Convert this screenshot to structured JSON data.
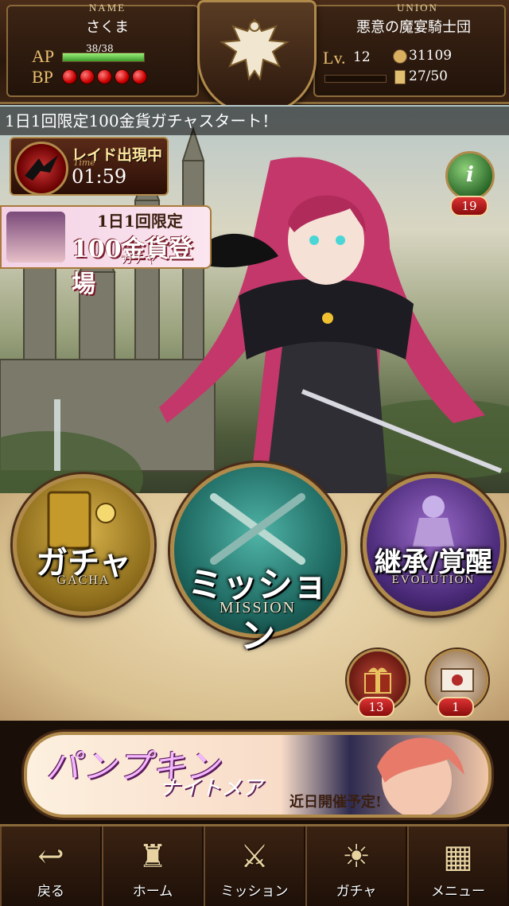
{
  "header": {
    "name_label": "NAME",
    "name": "さくま",
    "union_label": "UNION",
    "union": "悪意の魔宴騎士団",
    "ap_label": "AP",
    "ap_value": "38/38",
    "ap_fraction": 1.0,
    "bp_label": "BP",
    "bp_count": 5,
    "lv_label": "Lv.",
    "level": "12",
    "gold": "31109",
    "cards": "27/50"
  },
  "marquee": "1日1回限定100金貨ガチャスタート！",
  "raid": {
    "title": "レイド出現中",
    "time_label": "Time",
    "timer": "01:59"
  },
  "promo": {
    "line1": "1日1回限定",
    "line2": "100金貨登場",
    "line3": "ガチャ"
  },
  "info": {
    "badge": "19"
  },
  "main_buttons": {
    "gacha": {
      "label": "ガチャ",
      "sub": "GACHA"
    },
    "mission": {
      "label": "ミッション",
      "sub": "MISSION"
    },
    "evolution": {
      "label": "継承/覚醒",
      "sub": "EVOLUTION"
    }
  },
  "present": {
    "badge": "13"
  },
  "mail": {
    "badge": "1"
  },
  "banner": {
    "title1": "パンプキン",
    "title2": "ナイトメア",
    "subtitle": "近日開催予定!"
  },
  "nav": {
    "back": "戻る",
    "home": "ホーム",
    "mission": "ミッション",
    "gacha": "ガチャ",
    "menu": "メニュー"
  }
}
